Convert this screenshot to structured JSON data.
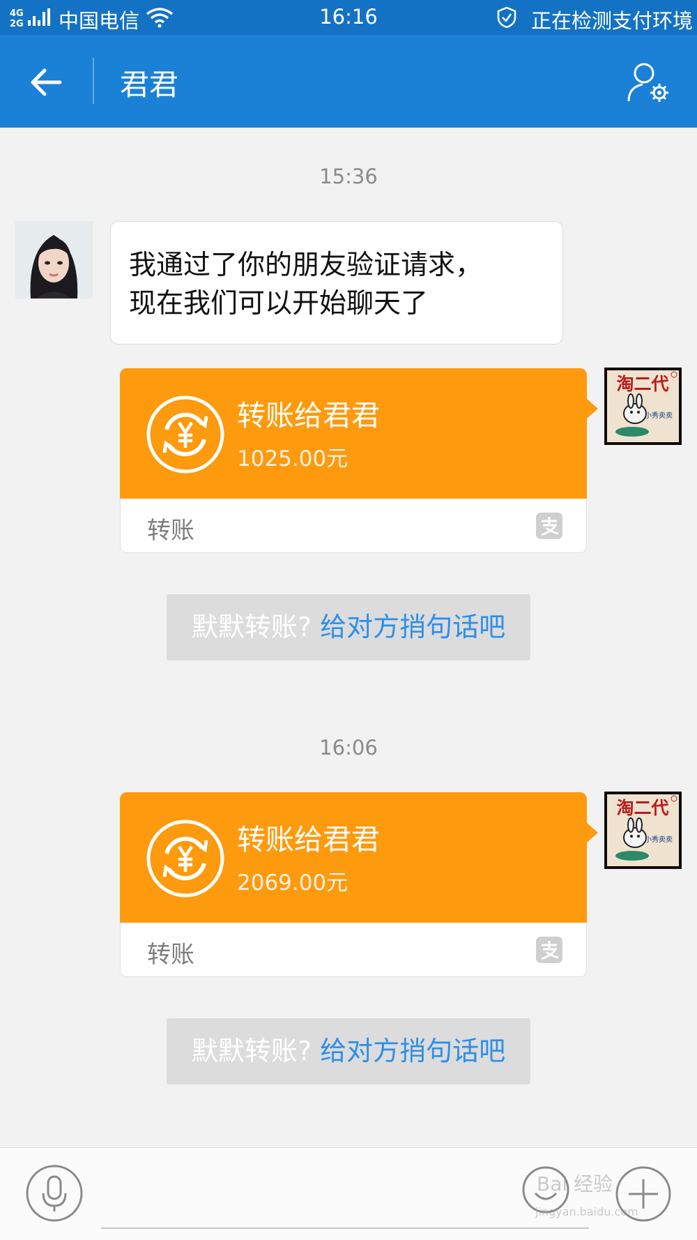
{
  "status_bar": {
    "network": "4G 2G",
    "carrier": "中国电信",
    "time": "16:16",
    "security_text": "正在检测支付环境"
  },
  "header": {
    "title": "君君",
    "back_icon": "arrow-left-icon",
    "settings_icon": "person-gear-icon"
  },
  "messages": [
    {
      "type": "timestamp",
      "text": "15:36"
    },
    {
      "type": "text",
      "side": "left",
      "text_line1": "我通过了你的朋友验证请求，",
      "text_line2": "现在我们可以开始聊天了"
    },
    {
      "type": "transfer",
      "side": "right",
      "title": "转账给君君",
      "amount": "1025.00元",
      "label": "转账"
    },
    {
      "type": "hint",
      "prefix": "默默转账?",
      "link": "给对方捎句话吧"
    },
    {
      "type": "timestamp",
      "text": "16:06"
    },
    {
      "type": "transfer",
      "side": "right",
      "title": "转账给君君",
      "amount": "2069.00元",
      "label": "转账"
    },
    {
      "type": "hint",
      "prefix": "默默转账?",
      "link": "给对方捎句话吧"
    }
  ],
  "avatars": {
    "right_text": "淘二代",
    "right_subtext": "小秀卖卖"
  },
  "input_bar": {
    "watermark": "Bai 经验",
    "watermark_url": "jingyan.baidu.com"
  },
  "colors": {
    "header": "#1a81d7",
    "status_bar": "#1472c4",
    "transfer_orange": "#fe9a0e",
    "link_blue": "#2d8fe8"
  }
}
